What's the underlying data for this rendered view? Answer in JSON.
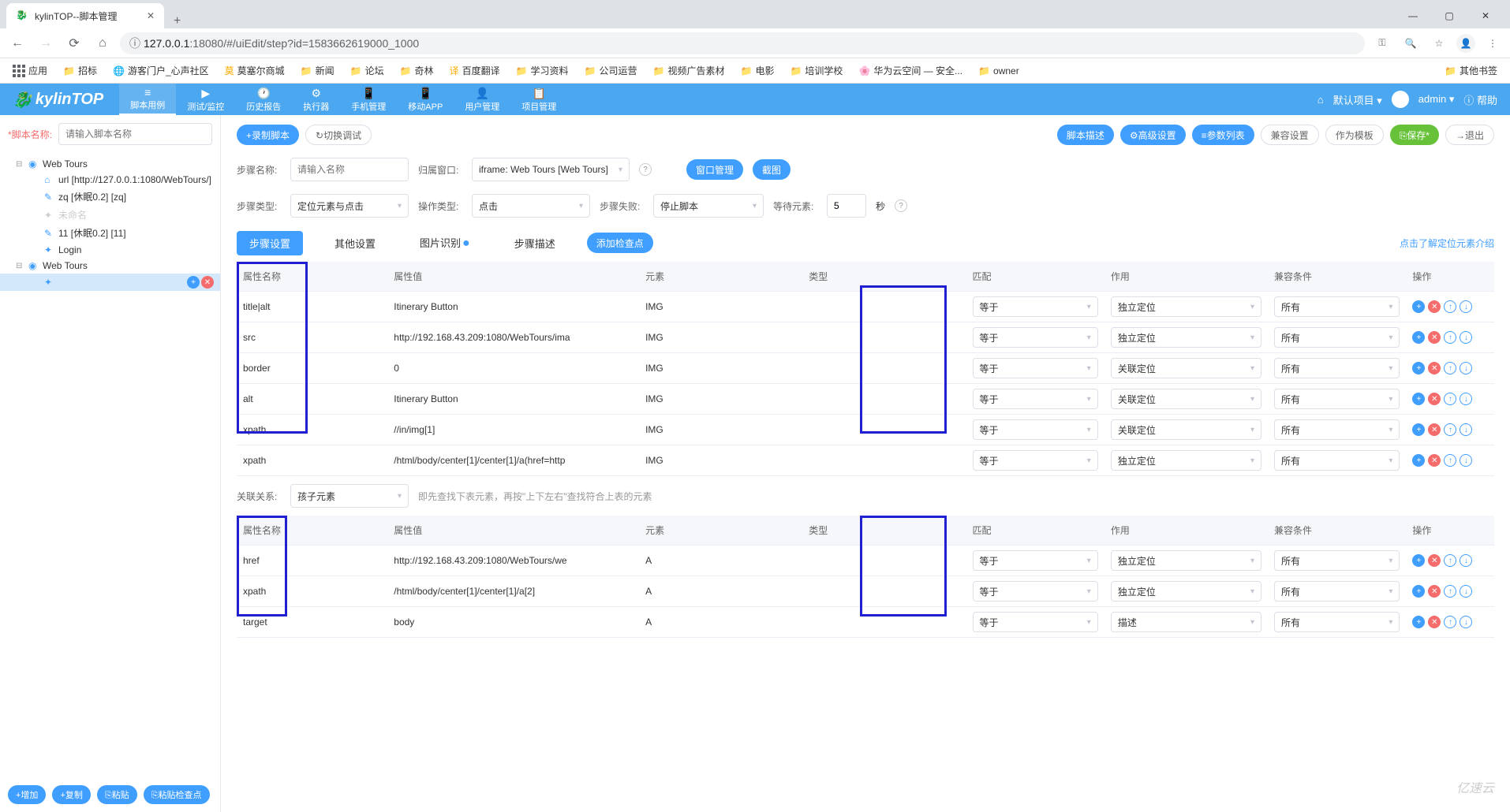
{
  "browser": {
    "tab_title": "kylinTOP--脚本管理",
    "url_host": "127.0.0.1",
    "url_port": ":18080",
    "url_path": "/#/uiEdit/step?id=1583662619000_1000",
    "window": {
      "min": "—",
      "max": "▢",
      "close": "✕"
    }
  },
  "bookmarks": {
    "apps": "应用",
    "items": [
      "招标",
      "游客门户_心声社区",
      "莫塞尔商城",
      "新闻",
      "论坛",
      "奇林",
      "百度翻译",
      "学习资料",
      "公司运营",
      "视频广告素材",
      "电影",
      "培训学校",
      "华为云空间 — 安全...",
      "owner"
    ],
    "other": "其他书签"
  },
  "header": {
    "logo": "kylinTOP",
    "tabs": [
      "脚本用例",
      "测试/监控",
      "历史报告",
      "执行器",
      "手机管理",
      "移动APP",
      "用户管理",
      "项目管理"
    ],
    "project": "默认项目",
    "user": "admin",
    "help": "帮助",
    "home_icon": "⌂"
  },
  "sidebar": {
    "script_name_label": "*脚本名称:",
    "script_name_placeholder": "请输入脚本名称",
    "tree": [
      {
        "label": "Web Tours",
        "level": 0,
        "toggle": "⊟",
        "icon": "◉"
      },
      {
        "label": "url [http://127.0.0.1:1080/WebTours/]",
        "level": 1,
        "icon": "⌂"
      },
      {
        "label": "zq [休眠0.2] [zq]",
        "level": 1,
        "icon": "✎"
      },
      {
        "label": "未命名",
        "level": 1,
        "icon": "✦",
        "muted": true
      },
      {
        "label": "11 [休眠0.2] [11]",
        "level": 1,
        "icon": "✎"
      },
      {
        "label": "Login",
        "level": 1,
        "icon": "✦"
      },
      {
        "label": "Web Tours",
        "level": 0,
        "toggle": "⊟",
        "icon": "◉"
      },
      {
        "label": "",
        "level": 1,
        "icon": "✦",
        "selected": true
      }
    ],
    "buttons": {
      "add": "+增加",
      "copy": "+复制",
      "paste": "⎘粘贴",
      "paste_check": "⎘粘贴检查点"
    }
  },
  "content": {
    "top_buttons": {
      "record": "+录制脚本",
      "switch": "↻切换调试"
    },
    "right_buttons": [
      "脚本描述",
      "⚙高级设置",
      "≡参数列表",
      "兼容设置",
      "作为模板",
      "⎘保存*",
      "→退出"
    ],
    "form": {
      "step_name_label": "步骤名称:",
      "step_name_placeholder": "请输入名称",
      "window_label": "归属窗口:",
      "window_value": "iframe: Web Tours [Web Tours]",
      "win_mgmt": "窗口管理",
      "screenshot": "截图",
      "step_type_label": "步骤类型:",
      "step_type_value": "定位元素与点击",
      "op_type_label": "操作类型:",
      "op_type_value": "点击",
      "fail_label": "步骤失败:",
      "fail_value": "停止脚本",
      "wait_label": "等待元素:",
      "wait_value": "5",
      "wait_unit": "秒"
    },
    "sub_tabs": [
      "步骤设置",
      "其他设置",
      "图片识别",
      "步骤描述"
    ],
    "add_checkpoint": "添加检查点",
    "link_help": "点击了解定位元素介绍",
    "table_headers": [
      "属性名称",
      "属性值",
      "元素",
      "类型",
      "匹配",
      "作用",
      "兼容条件",
      "操作"
    ],
    "rows1": [
      {
        "name": "title|alt",
        "value": "Itinerary Button",
        "elem": "IMG",
        "match": "等于",
        "role": "独立定位",
        "compat": "所有"
      },
      {
        "name": "src",
        "value": "http://192.168.43.209:1080/WebTours/ima",
        "elem": "IMG",
        "match": "等于",
        "role": "独立定位",
        "compat": "所有"
      },
      {
        "name": "border",
        "value": "0",
        "elem": "IMG",
        "match": "等于",
        "role": "关联定位",
        "compat": "所有"
      },
      {
        "name": "alt",
        "value": "Itinerary Button",
        "elem": "IMG",
        "match": "等于",
        "role": "关联定位",
        "compat": "所有"
      },
      {
        "name": "xpath",
        "value": "//in/img[1]",
        "elem": "IMG",
        "match": "等于",
        "role": "关联定位",
        "compat": "所有"
      },
      {
        "name": "xpath",
        "value": "/html/body/center[1]/center[1]/a(href=http",
        "elem": "IMG",
        "match": "等于",
        "role": "独立定位",
        "compat": "所有"
      }
    ],
    "relation": {
      "label": "关联关系:",
      "value": "孩子元素",
      "hint": "即先查找下表元素，再按\"上下左右\"查找符合上表的元素"
    },
    "rows2": [
      {
        "name": "href",
        "value": "http://192.168.43.209:1080/WebTours/we",
        "elem": "A",
        "match": "等于",
        "role": "独立定位",
        "compat": "所有"
      },
      {
        "name": "xpath",
        "value": "/html/body/center[1]/center[1]/a[2]",
        "elem": "A",
        "match": "等于",
        "role": "独立定位",
        "compat": "所有"
      },
      {
        "name": "target",
        "value": "body",
        "elem": "A",
        "match": "等于",
        "role": "描述",
        "compat": "所有"
      }
    ]
  },
  "watermark": "亿速云"
}
